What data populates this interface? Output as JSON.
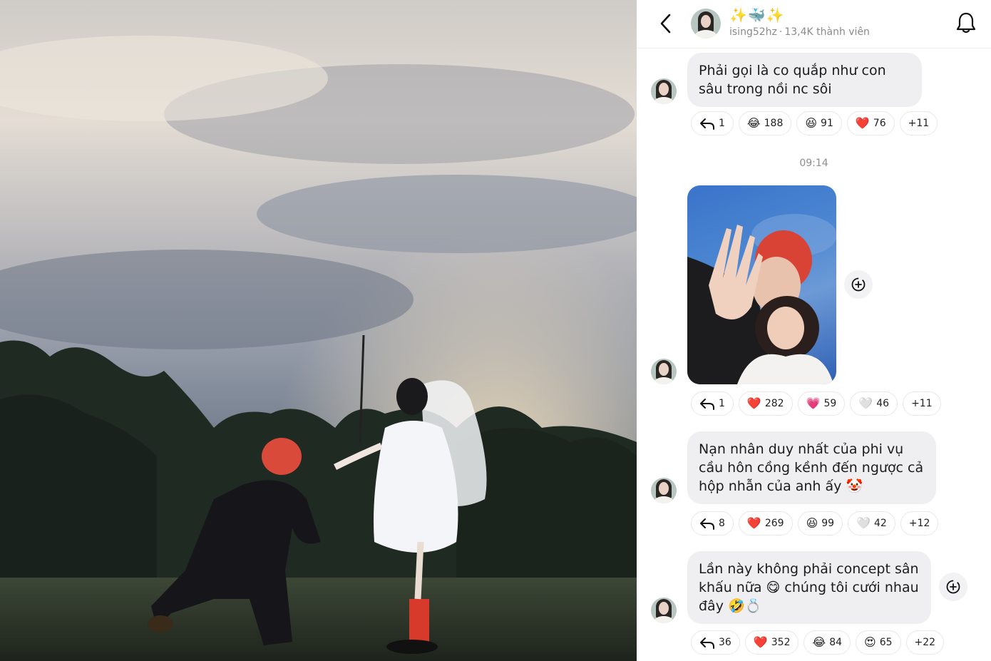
{
  "header": {
    "title": "✨🐳✨",
    "username": "ising52hz",
    "members": "13,4K thành viên"
  },
  "messages": [
    {
      "text": "Phải gọi là co quắp như con sâu trong nồi nc sôi",
      "reactions": {
        "reply": "1",
        "r1_emoji": "😂",
        "r1": "188",
        "r2_emoji": "😆",
        "r2": "91",
        "r3_emoji": "❤️",
        "r3": "76",
        "more": "+11"
      }
    },
    {
      "timestamp": "09:14",
      "reactions": {
        "reply": "1",
        "r1_emoji": "❤️",
        "r1": "282",
        "r2_emoji": "💗",
        "r2": "59",
        "r3_emoji": "🤍",
        "r3": "46",
        "more": "+11"
      }
    },
    {
      "text": "Nạn nhân duy nhất của phi vụ cầu hôn cồng kềnh đến ngược cả hộp nhẫn của anh ấy 🤡",
      "reactions": {
        "reply": "8",
        "r1_emoji": "❤️",
        "r1": "269",
        "r2_emoji": "😆",
        "r2": "99",
        "r3_emoji": "🤍",
        "r3": "42",
        "more": "+12"
      }
    },
    {
      "text": "Lần này không phải concept sân khấu nữa 😋 chúng tôi cưới nhau đây 🤣💍",
      "reactions": {
        "reply": "36",
        "r1_emoji": "❤️",
        "r1": "352",
        "r2_emoji": "😂",
        "r2": "84",
        "r3_emoji": "😍",
        "r3": "65",
        "more": "+22"
      }
    }
  ],
  "icons": {
    "back": "chevron-left-icon",
    "bell": "bell-icon",
    "reply": "reply-arrow-icon",
    "share": "share-plus-icon"
  },
  "colors": {
    "bubble": "#efeff1",
    "muted": "#8a8a8a",
    "heart": "#e0245e"
  }
}
